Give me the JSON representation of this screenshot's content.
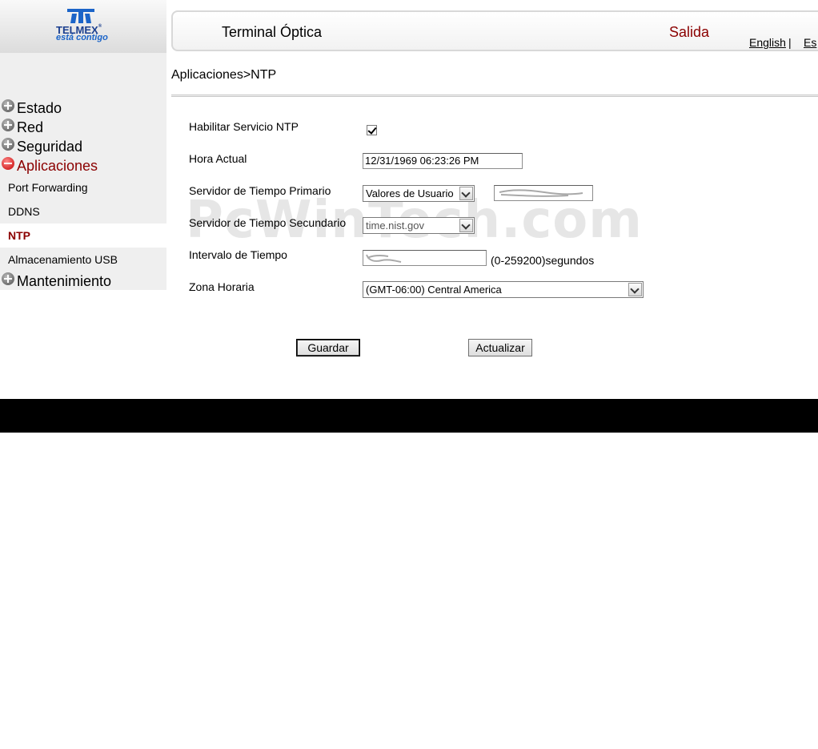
{
  "logo": {
    "name": "TELMEX",
    "tagline": "está contigo",
    "registered": "®"
  },
  "header": {
    "title": "Terminal Óptica",
    "logout": "Salida",
    "lang_english": "English",
    "lang_separator": "|",
    "lang_spanish": "Es"
  },
  "sidebar": {
    "items": [
      {
        "label": "Estado",
        "state": "collapsed"
      },
      {
        "label": "Red",
        "state": "collapsed"
      },
      {
        "label": "Seguridad",
        "state": "collapsed"
      },
      {
        "label": "Aplicaciones",
        "state": "expanded"
      },
      {
        "label": "Mantenimiento",
        "state": "collapsed"
      }
    ],
    "subitems": [
      {
        "label": "Port Forwarding"
      },
      {
        "label": "DDNS"
      },
      {
        "label": "NTP",
        "selected": true
      },
      {
        "label": "Almacenamiento USB"
      }
    ]
  },
  "breadcrumb": "Aplicaciones>NTP",
  "form": {
    "enable_label": "Habilitar Servicio NTP",
    "enable_checked": true,
    "current_time_label": "Hora Actual",
    "current_time_value": "12/31/1969 06:23:26 PM",
    "primary_label": "Servidor de Tiempo Primario",
    "primary_select": "Valores de Usuario",
    "secondary_label": "Servidor de Tiempo Secundario",
    "secondary_select": "time.nist.gov",
    "interval_label": "Intervalo de Tiempo",
    "interval_hint": "(0-259200)segundos",
    "timezone_label": "Zona Horaria",
    "timezone_select": "(GMT-06:00) Central America"
  },
  "buttons": {
    "save": "Guardar",
    "refresh": "Actualizar"
  },
  "watermark": "PcWinTech.com",
  "colors": {
    "accent": "#8b0000",
    "brand_blue": "#1b3f8f",
    "sidebar_bg": "#efefef",
    "footer_bg": "#000000"
  }
}
